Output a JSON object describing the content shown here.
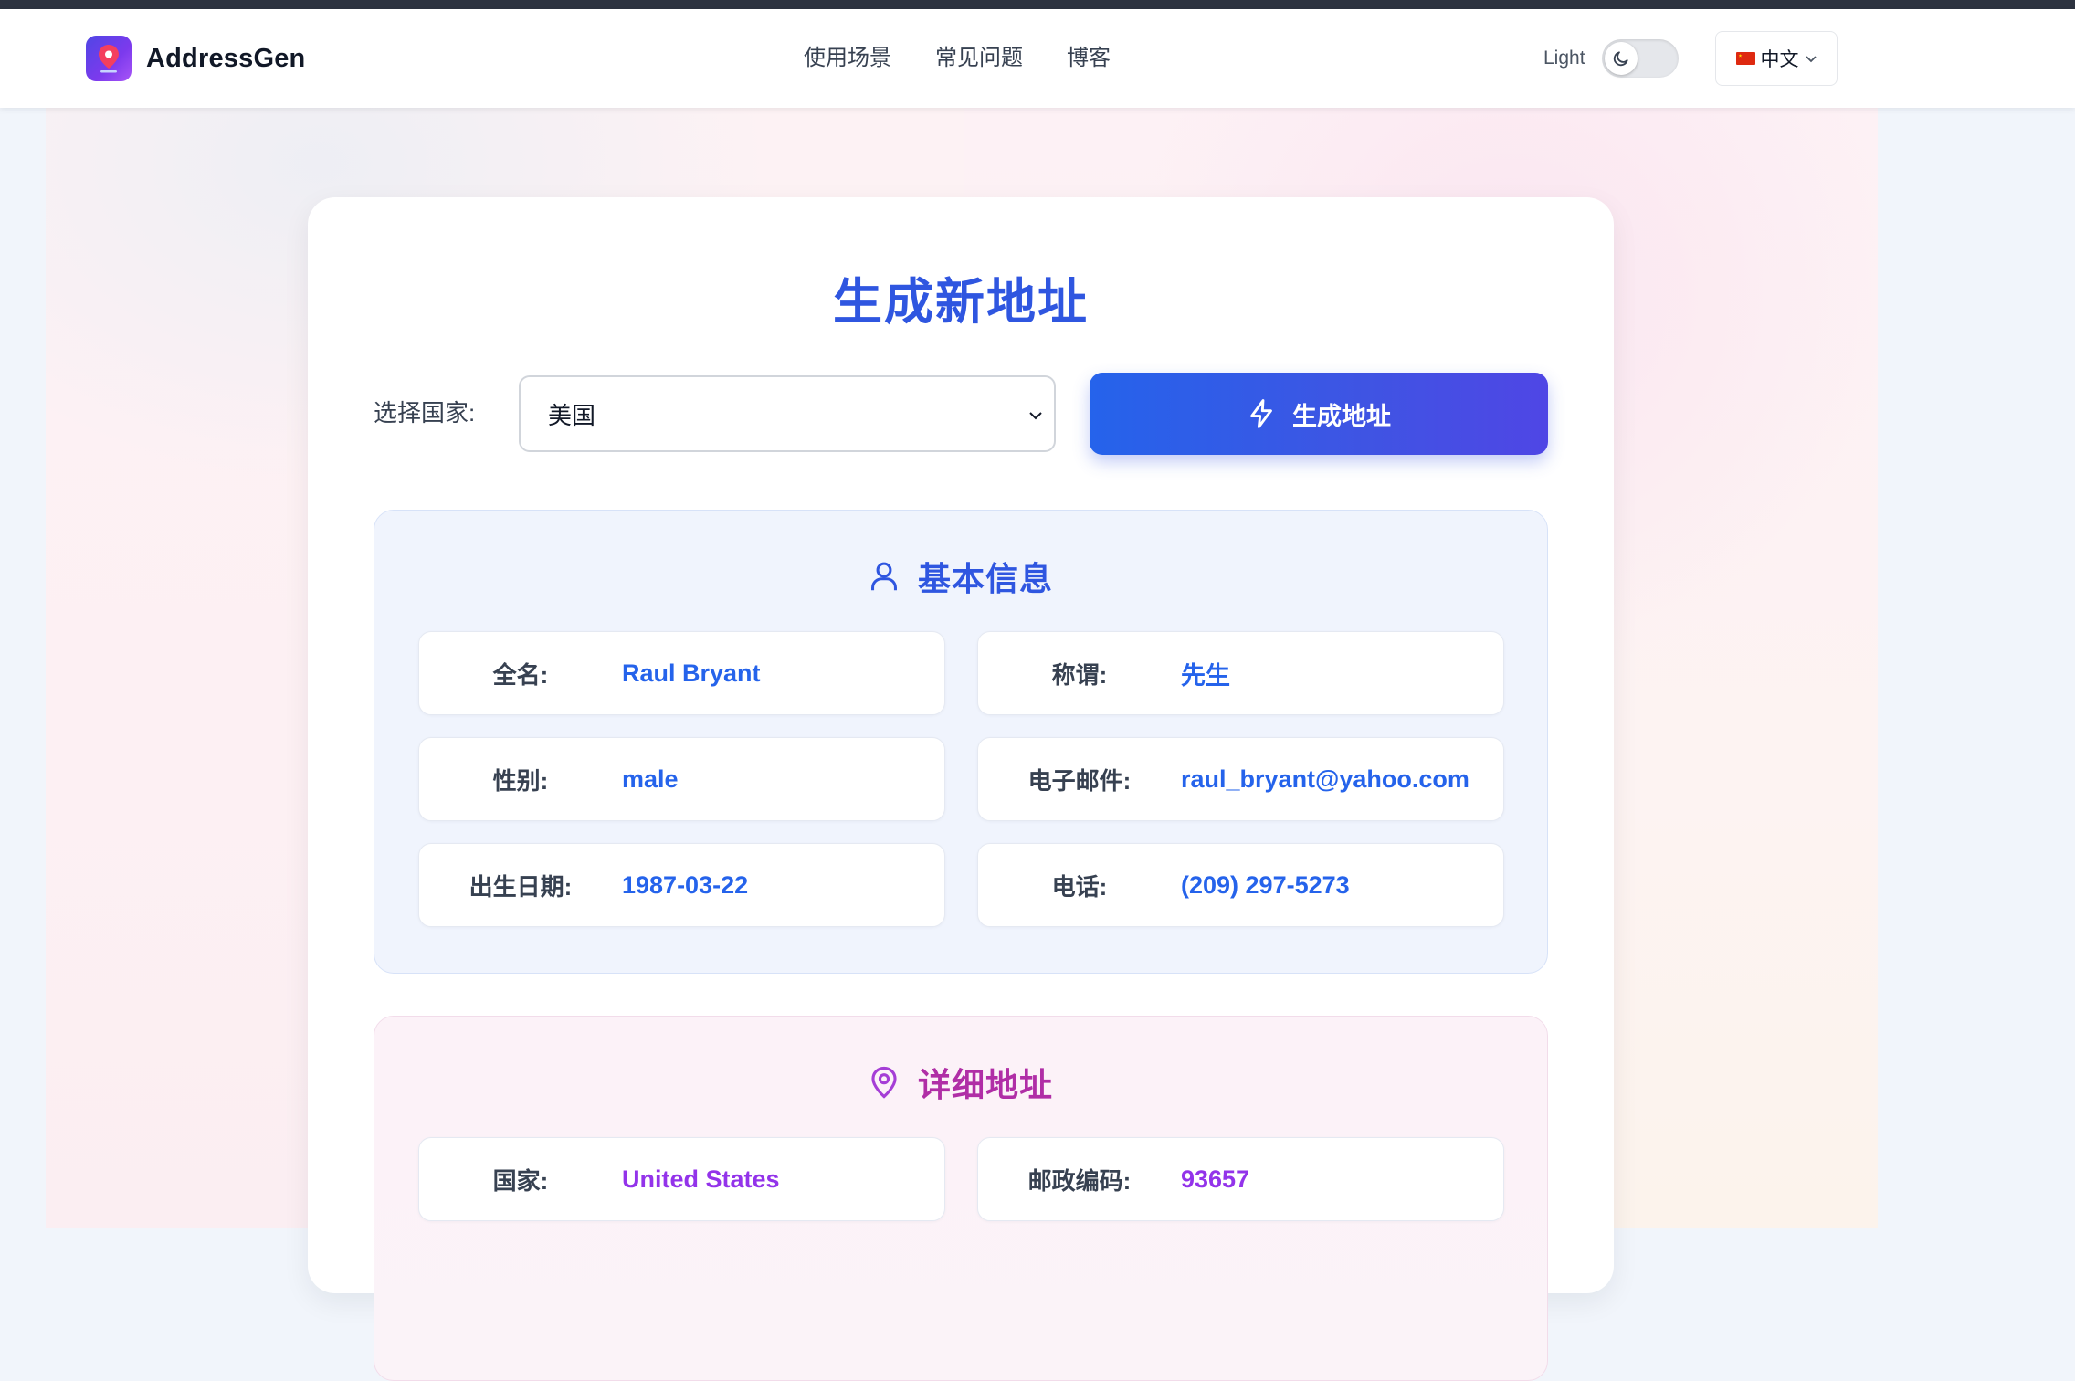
{
  "header": {
    "logo_text": "AddressGen",
    "nav": [
      "使用场景",
      "常见问题",
      "博客"
    ],
    "theme_label": "Light",
    "language": "中文"
  },
  "generator": {
    "title": "生成新地址",
    "country_label": "选择国家:",
    "country_selected": "美国",
    "generate_button": "生成地址"
  },
  "basic_info": {
    "title": "基本信息",
    "fields": [
      {
        "label": "全名:",
        "value": "Raul Bryant"
      },
      {
        "label": "称谓:",
        "value": "先生"
      },
      {
        "label": "性别:",
        "value": "male"
      },
      {
        "label": "电子邮件:",
        "value": "raul_bryant@yahoo.com"
      },
      {
        "label": "出生日期:",
        "value": "1987-03-22"
      },
      {
        "label": "电话:",
        "value": "(209) 297-5273"
      }
    ]
  },
  "address": {
    "title": "详细地址",
    "fields": [
      {
        "label": "国家:",
        "value": "United States"
      },
      {
        "label": "邮政编码:",
        "value": "93657"
      }
    ]
  },
  "colors": {
    "primary": "#2f56e0",
    "accent_purple": "#9333ea",
    "address_title": "#b02ea6"
  },
  "icons": {
    "logo": "map-pin-icon",
    "theme": "moon-icon",
    "button": "lightning-icon",
    "basic": "user-icon",
    "address": "map-pin-icon"
  }
}
